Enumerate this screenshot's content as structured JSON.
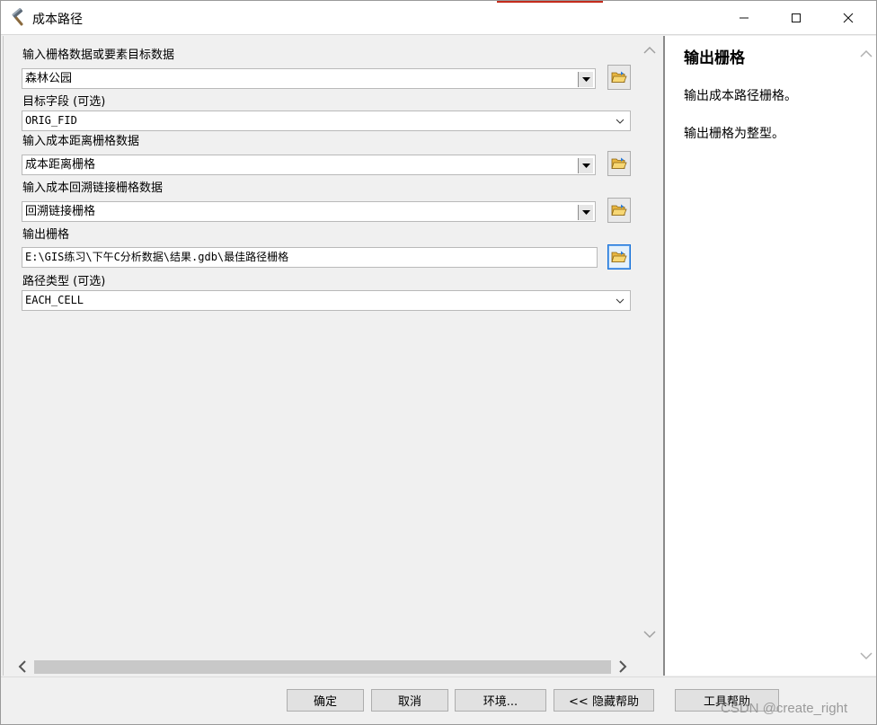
{
  "window": {
    "title": "成本路径",
    "icons": {
      "app": "hammer-icon",
      "minimize": "minimize-icon",
      "maximize": "maximize-icon",
      "close": "close-icon"
    },
    "accent_color": "#c42b1c"
  },
  "params": {
    "in_source": {
      "label": "输入栅格数据或要素目标数据",
      "value": "森林公园"
    },
    "dest_field": {
      "label": "目标字段 (可选)",
      "value": "ORIG_FID"
    },
    "in_cost_distance": {
      "label": "输入成本距离栅格数据",
      "value": "成本距离栅格"
    },
    "in_backlink": {
      "label": "输入成本回溯链接栅格数据",
      "value": "回溯链接栅格"
    },
    "out_raster": {
      "label": "输出栅格",
      "value": "E:\\GIS练习\\下午C分析数据\\结果.gdb\\最佳路径栅格"
    },
    "path_type": {
      "label": "路径类型 (可选)",
      "value": "EACH_CELL"
    }
  },
  "help": {
    "title": "输出栅格",
    "paragraphs": [
      "输出成本路径栅格。",
      "输出栅格为整型。"
    ]
  },
  "buttons": {
    "ok": "确定",
    "cancel": "取消",
    "env": "环境...",
    "hide_help": "<< 隐藏帮助",
    "tool_help": "工具帮助"
  },
  "watermark": "CSDN @create_right"
}
